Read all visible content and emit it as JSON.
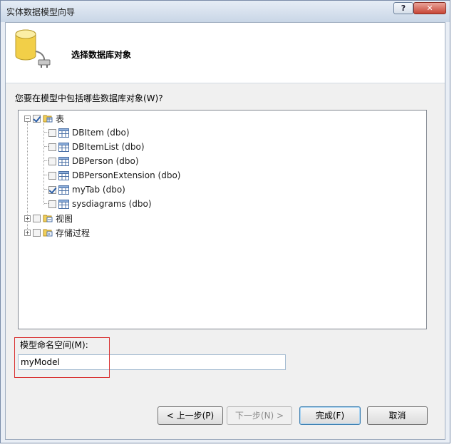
{
  "window": {
    "title": "实体数据模型向导",
    "help_label": "?",
    "close_label": "✕"
  },
  "header": {
    "step_title": "选择数据库对象"
  },
  "question": "您要在模型中包括哪些数据库对象(W)?",
  "tree": {
    "tables": {
      "label": "表",
      "checked": true,
      "expander": "−"
    },
    "table_items": [
      {
        "label": "DBItem (dbo)",
        "checked": false
      },
      {
        "label": "DBItemList (dbo)",
        "checked": false
      },
      {
        "label": "DBPerson (dbo)",
        "checked": false
      },
      {
        "label": "DBPersonExtension (dbo)",
        "checked": false
      },
      {
        "label": "myTab (dbo)",
        "checked": true
      },
      {
        "label": "sysdiagrams (dbo)",
        "checked": false
      }
    ],
    "views": {
      "label": "视图",
      "checked": false,
      "expander": "+"
    },
    "procs": {
      "label": "存储过程",
      "checked": false,
      "expander": "+"
    }
  },
  "namespace": {
    "label": "模型命名空间(M):",
    "value": "myModel"
  },
  "buttons": {
    "back": "< 上一步(P)",
    "next": "下一步(N) >",
    "finish": "完成(F)",
    "cancel": "取消"
  },
  "colors": {
    "highlight_box": "#d93333",
    "title_bar": "#c9d6e6"
  }
}
